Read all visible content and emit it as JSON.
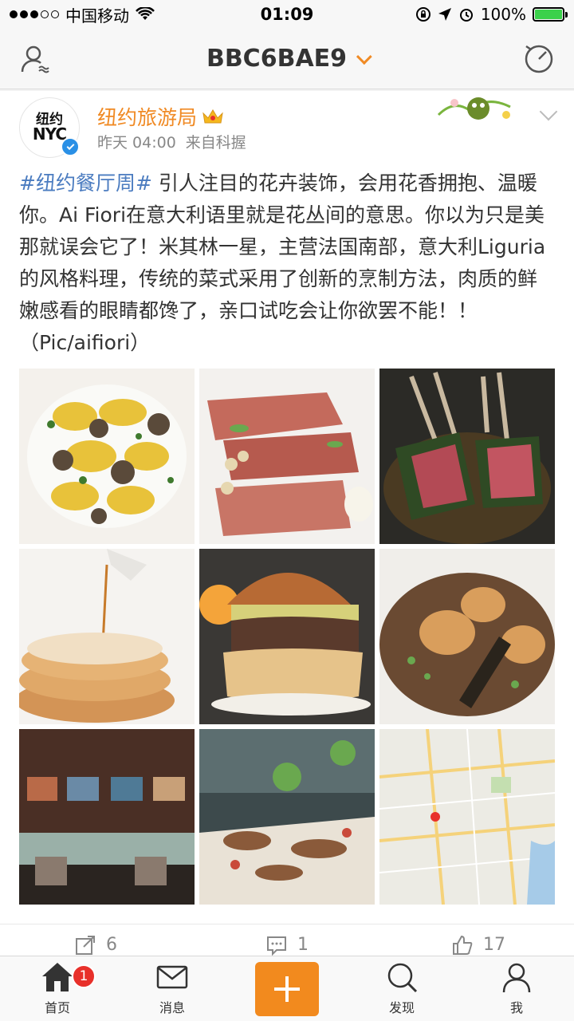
{
  "status_bar": {
    "carrier": "中国移动",
    "time": "01:09",
    "battery": "100%"
  },
  "nav": {
    "title": "BBC6BAE9",
    "left_icon": "friend-add-icon",
    "right_icon": "radar-icon"
  },
  "post": {
    "user_name": "纽约旅游局",
    "avatar_logo": [
      "纽约",
      "NYC"
    ],
    "time": "昨天 04:00",
    "source": "来自科握",
    "hashtag": "#纽约餐厅周#",
    "body": " 引人注目的花卉装饰，会用花香拥抱、温暖你。Ai Fiori在意大利语里就是花丛间的意思。你以为只是美那就误会它了！米其林一星，主营法国南部，意大利Liguria的风格料理，传统的菜式采用了创新的烹制方法，肉质的鲜嫩感看的眼睛都馋了，亲口试吃会让你欲罢不能！！（Pic/aifiori）",
    "images": [
      {
        "name": "pasta-photo"
      },
      {
        "name": "duck-breast-photo"
      },
      {
        "name": "lamb-rack-photo"
      },
      {
        "name": "pancakes-photo"
      },
      {
        "name": "burger-photo"
      },
      {
        "name": "scallops-photo"
      },
      {
        "name": "dining-room-photo"
      },
      {
        "name": "buffet-photo"
      },
      {
        "name": "map-photo"
      }
    ],
    "actions": {
      "repost_count": "6",
      "comment_count": "1",
      "like_count": "17"
    }
  },
  "tabs": [
    {
      "label": "首页",
      "icon": "home-icon",
      "badge": "1"
    },
    {
      "label": "消息",
      "icon": "message-icon"
    },
    {
      "label": "",
      "icon": "plus-icon"
    },
    {
      "label": "发现",
      "icon": "search-icon"
    },
    {
      "label": "我",
      "icon": "profile-icon"
    }
  ],
  "colors": {
    "accent": "#f08a24",
    "hashtag": "#4b7cc0",
    "badge": "#e8302a"
  }
}
